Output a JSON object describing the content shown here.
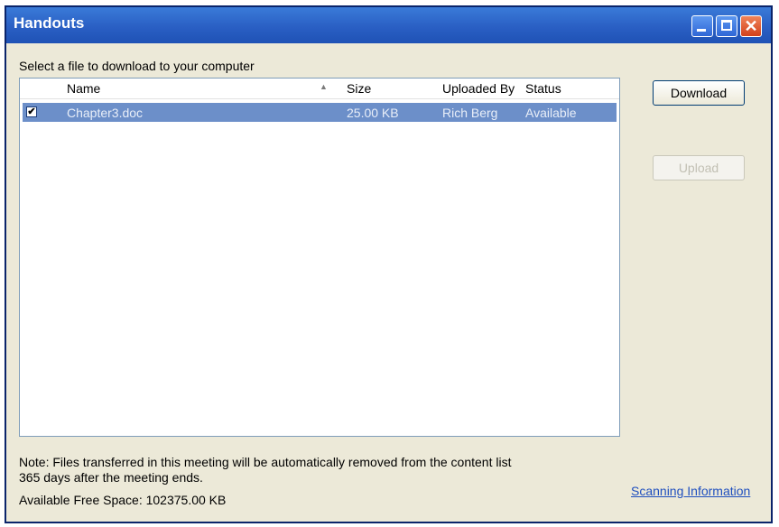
{
  "window": {
    "title": "Handouts"
  },
  "prompt": "Select a file to download to your computer",
  "columns": [
    "Name",
    "Size",
    "Uploaded By",
    "Status"
  ],
  "files": [
    {
      "checked": true,
      "name": "Chapter3.doc",
      "size": "25.00 KB",
      "uploaded_by": "Rich Berg",
      "status": "Available"
    }
  ],
  "buttons": {
    "download": "Download",
    "upload": "Upload"
  },
  "note": "Note: Files transferred in this meeting will be automatically removed from the content list 365 days after the meeting ends.",
  "free_space": "Available Free Space: 102375.00 KB",
  "link": "Scanning Information",
  "icons": {
    "minimize": "minimize-icon",
    "maximize": "maximize-icon",
    "close": "close-icon",
    "sort": "sort-ascending-icon",
    "check": "checkmark-icon"
  },
  "colors": {
    "titlebar": "#2a5fc4",
    "selection": "#6c8fc9",
    "face": "#ece9d8"
  }
}
